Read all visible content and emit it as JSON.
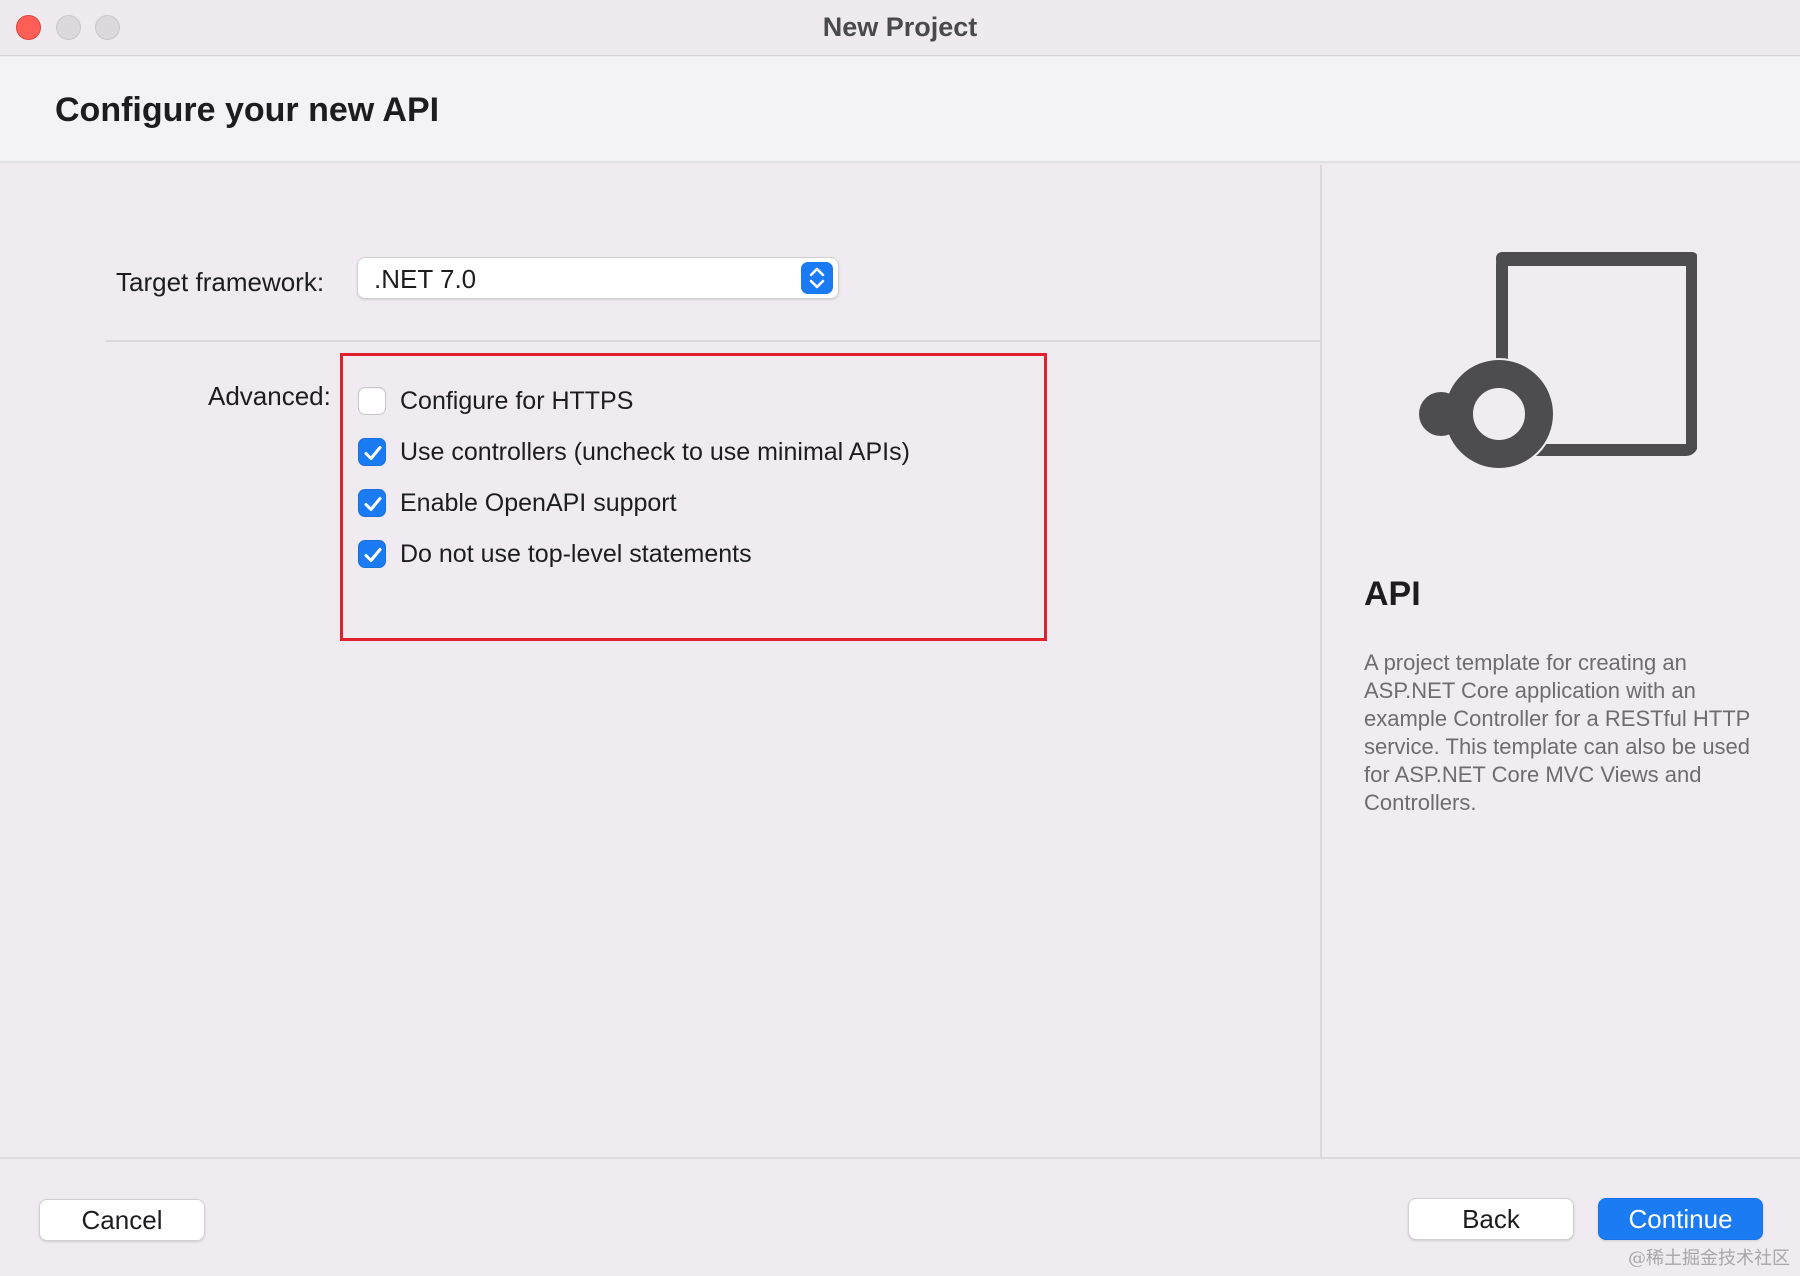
{
  "window": {
    "title": "New Project"
  },
  "header": {
    "title": "Configure your new API"
  },
  "form": {
    "target_framework_label": "Target framework:",
    "target_framework_value": ".NET 7.0",
    "advanced_label": "Advanced:",
    "options": [
      {
        "label": "Configure for HTTPS",
        "checked": false
      },
      {
        "label": "Use controllers (uncheck to use minimal APIs)",
        "checked": true
      },
      {
        "label": "Enable OpenAPI support",
        "checked": true
      },
      {
        "label": "Do not use top-level statements",
        "checked": true
      }
    ]
  },
  "side_panel": {
    "icon": "api-template-icon",
    "title": "API",
    "description": "A project template for creating an ASP.NET Core application with an example Controller for a RESTful HTTP service. This template can also be used for ASP.NET Core MVC Views and Controllers."
  },
  "footer": {
    "cancel_label": "Cancel",
    "back_label": "Back",
    "continue_label": "Continue"
  },
  "watermark": "@稀土掘金技术社区",
  "colors": {
    "accent": "#1a7bf2",
    "highlight_border": "#e0202b",
    "close_button": "#ff5f57"
  }
}
